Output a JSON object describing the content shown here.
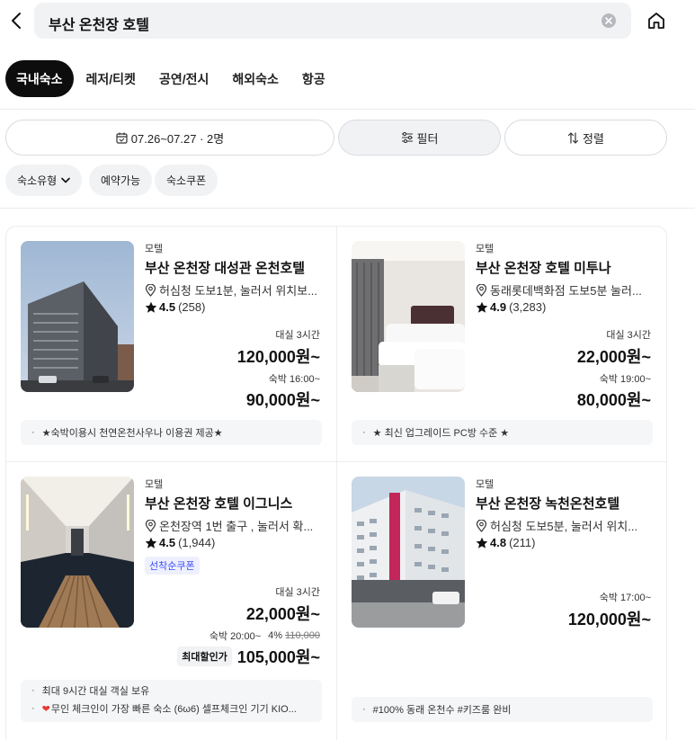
{
  "search": {
    "query": "부산 온천장 호텔"
  },
  "tabs": [
    "국내숙소",
    "레저/티켓",
    "공연/전시",
    "해외숙소",
    "항공"
  ],
  "filters": {
    "date": "07.26~07.27 · 2명",
    "filter": "필터",
    "sort": "정렬",
    "chips": [
      "숙소유형",
      "예약가능",
      "숙소쿠폰"
    ]
  },
  "cards": [
    {
      "category": "모텔",
      "title": "부산 온천장 대성관 온천호텔",
      "location": "허심청 도보1분, 눌러서 위치보...",
      "rating": "4.5",
      "reviews": "(258)",
      "rent_label": "대실 3시간",
      "rent_price": "120,000원~",
      "stay_label": "숙박 16:00~",
      "stay_price": "90,000원~",
      "notes": [
        "★숙박이용시 천연온천사우나 이용권 제공★"
      ]
    },
    {
      "category": "모텔",
      "title": "부산 온천장 호텔 미투나",
      "location": "동래롯데백화점 도보5분 눌러...",
      "rating": "4.9",
      "reviews": "(3,283)",
      "rent_label": "대실 3시간",
      "rent_price": "22,000원~",
      "stay_label": "숙박 19:00~",
      "stay_price": "80,000원~",
      "notes": [
        "★ 최신 업그레이드 PC방 수준 ★"
      ]
    },
    {
      "category": "모텔",
      "title": "부산 온천장 호텔 이그니스",
      "location": "온천장역 1번 출구 , 눌러서 확...",
      "rating": "4.5",
      "reviews": "(1,944)",
      "coupon": "선착순쿠폰",
      "rent_label": "대실 3시간",
      "rent_price": "22,000원~",
      "stay_label": "숙박 20:00~",
      "discount": "4%",
      "original_price": "110,000",
      "badge": "최대할인가",
      "stay_price": "105,000원~",
      "notes": [
        "최대 9시간 대실 객실 보유",
        "무인 체크인이 가장 빠른 숙소 (6ω6) 셀프체크인 기기 KIO..."
      ]
    },
    {
      "category": "모텔",
      "title": "부산 온천장 녹천온천호텔",
      "location": "허심청 도보5분, 눌러서 위치...",
      "rating": "4.8",
      "reviews": "(211)",
      "stay_label": "숙박 17:00~",
      "stay_price": "120,000원~",
      "notes": [
        "#100% 동래 온천수 #키즈룸 완비"
      ]
    }
  ],
  "colors": {
    "accent": "#0d0d0d",
    "coupon": "#3b4ef5",
    "heart": "#e53935"
  }
}
